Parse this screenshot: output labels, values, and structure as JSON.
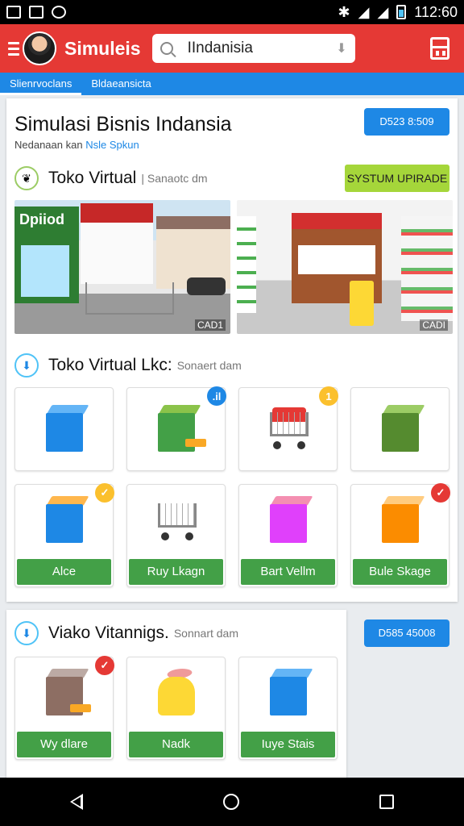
{
  "status_bar": {
    "time": "112:60"
  },
  "app_bar": {
    "title": "Simuleis",
    "search_value": "IIndanisia"
  },
  "tabs": [
    {
      "label": "Slienrvoclans"
    },
    {
      "label": "Bldaeansicta"
    }
  ],
  "main": {
    "headline": "Simulasi Bisnis Indansia",
    "subline_prefix": "Nedanaan kan",
    "subline_highlight": "Nsle Spkun",
    "top_button": "D523 8:509",
    "section1": {
      "title": "Toko Virtual",
      "subtitle": "| Sanaotc dm",
      "action_button": "SYSTUM UPIRADE",
      "photos": [
        {
          "tag": "CAD1",
          "sign": "Dpiiod"
        },
        {
          "tag": "CADI"
        }
      ]
    },
    "section2": {
      "title": "Toko Virtual Lkc:",
      "subtitle": "Sonaert dam",
      "tiles_row1": [
        {
          "icon": "blue-box-icon",
          "badge": ""
        },
        {
          "icon": "green-box-money-icon",
          "badge": ".il"
        },
        {
          "icon": "shopping-cart-icon",
          "badge": "1"
        },
        {
          "icon": "green-box-icon",
          "badge": ""
        }
      ],
      "tiles_row2": [
        {
          "icon": "box-stack-icon",
          "badge": "✓",
          "label": "Alce"
        },
        {
          "icon": "cart-can-icon",
          "badge": "",
          "label": "Ruy Lkagn"
        },
        {
          "icon": "pink-box-icon",
          "badge": "",
          "label": "Bart Vellm"
        },
        {
          "icon": "orange-box-icon",
          "badge": "✓",
          "label": "Bule Skage"
        }
      ]
    }
  },
  "card2": {
    "title": "Viako Vitannigs.",
    "subtitle": "Sonnart dam",
    "button": "D585 45008",
    "tiles": [
      {
        "icon": "box-money-icon",
        "badge": "✓",
        "label": "Wy dlare"
      },
      {
        "icon": "cat-figure-icon",
        "badge": "",
        "label": "Nadk"
      },
      {
        "icon": "blue-box-icon",
        "badge": "",
        "label": "Iuye Stais"
      }
    ]
  },
  "colors": {
    "app_bar": "#e53935",
    "tab_strip": "#1e88e5",
    "accent_green": "#43a047",
    "upgrade_button": "#a5d63a"
  }
}
